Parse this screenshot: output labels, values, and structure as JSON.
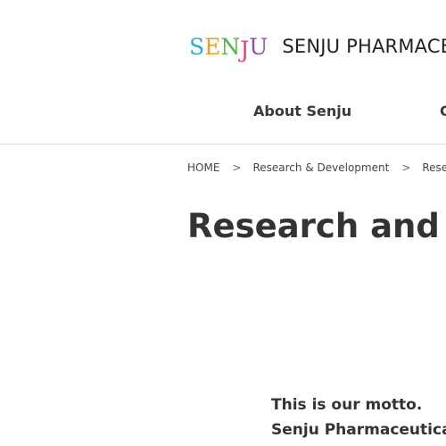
{
  "logo": {
    "mark_letters": [
      "S",
      "E",
      "N",
      "J",
      "U"
    ],
    "mark_colors": [
      "#2fa8d8",
      "#e8a020",
      "#4db848",
      "#e23d8a",
      "#8c4fb0"
    ],
    "company_name": "SENJU PHARMACE"
  },
  "nav": {
    "items": [
      {
        "label": "About Senju"
      },
      {
        "label": "C"
      }
    ]
  },
  "breadcrumb": {
    "items": [
      {
        "label": "HOME"
      },
      {
        "label": "Research & Development"
      },
      {
        "label": "Research &"
      }
    ],
    "separator": ">"
  },
  "main": {
    "title": "Research and De",
    "motto": "This is our motto.",
    "lead": "Senju Pharmaceutical has"
  }
}
